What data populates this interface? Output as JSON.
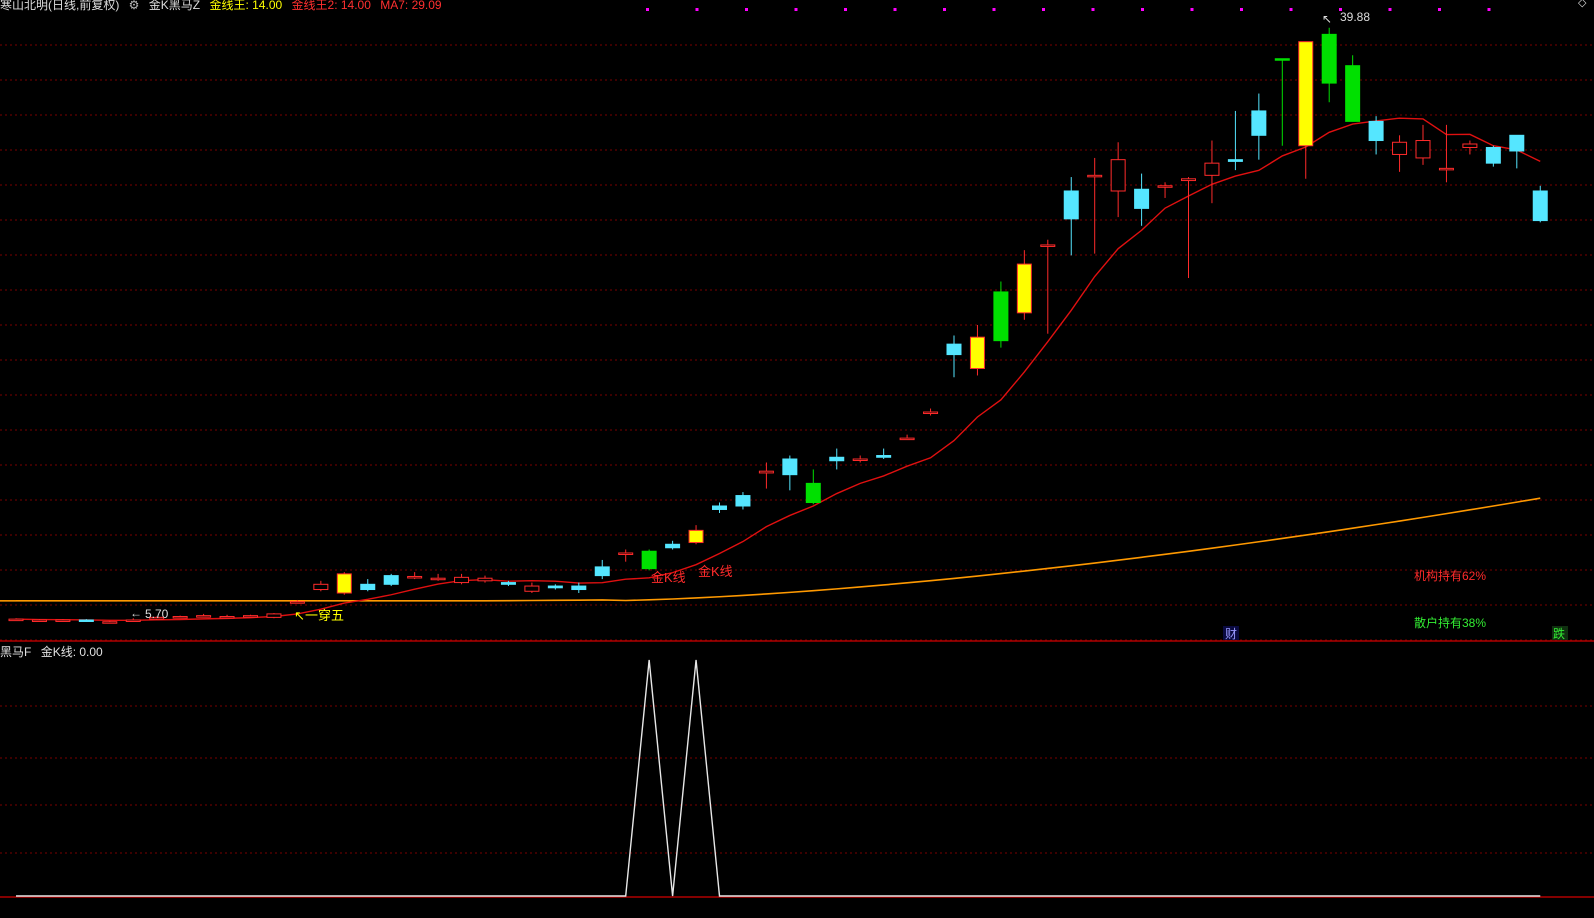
{
  "header": {
    "title": "寒山北明(日线,前复权)",
    "indicator": "金K黑马Z",
    "jxz": "金线王: 14.00",
    "jxz2": "金线王2: 14.00",
    "ma": "MA7: 29.09"
  },
  "subheader": {
    "name": "黑马F",
    "value": "金K线: 0.00"
  },
  "colors": {
    "background": "#000000",
    "grid": "#7a0000",
    "divider": "#b00000",
    "up_candle": "#ff2b2b",
    "yellow_candle": "#ffff00",
    "green_candle": "#00e000",
    "cyan_candle": "#55e6ff",
    "ma_line": "#e01010",
    "long_ma": "#ff9900",
    "signal_line": "#e8e8e8",
    "magenta_dots": "#ff00ff"
  },
  "chart_data": [
    {
      "type": "candlestick",
      "title": "",
      "series": [
        {
          "name": "K线",
          "candles": [
            [
              5.9,
              5.9,
              5.95,
              5.85
            ],
            [
              5.85,
              5.85,
              5.9,
              5.8
            ],
            [
              5.8,
              5.85,
              5.9,
              5.75
            ],
            [
              5.85,
              5.8,
              5.9,
              5.75
            ],
            [
              5.7,
              5.75,
              5.8,
              5.7
            ],
            [
              5.8,
              5.85,
              5.95,
              5.75
            ],
            [
              5.9,
              6.0,
              6.05,
              5.85
            ],
            [
              6.0,
              6.05,
              6.1,
              5.95
            ],
            [
              6.05,
              6.1,
              6.2,
              6.0
            ],
            [
              6.05,
              6.05,
              6.15,
              6.0
            ],
            [
              6.05,
              6.1,
              6.15,
              6.0
            ],
            [
              6.0,
              6.2,
              6.25,
              5.95
            ],
            [
              6.9,
              6.9,
              7.0,
              6.85
            ],
            [
              7.6,
              7.9,
              8.1,
              7.5
            ],
            [
              7.4,
              8.5,
              8.6,
              7.3
            ],
            [
              7.9,
              7.6,
              8.2,
              7.5
            ],
            [
              8.4,
              7.9,
              8.5,
              7.8
            ],
            [
              8.3,
              8.35,
              8.6,
              8.2
            ],
            [
              8.2,
              8.25,
              8.5,
              8.1
            ],
            [
              8.0,
              8.3,
              8.5,
              7.9
            ],
            [
              8.1,
              8.25,
              8.4,
              8.0
            ],
            [
              8.0,
              7.9,
              8.1,
              7.8
            ],
            [
              7.5,
              7.8,
              8.0,
              7.4
            ],
            [
              7.8,
              7.7,
              7.9,
              7.6
            ],
            [
              7.8,
              7.6,
              8.0,
              7.4
            ],
            [
              8.9,
              8.4,
              9.3,
              8.2
            ],
            [
              9.7,
              9.7,
              9.9,
              9.2
            ],
            [
              9.8,
              8.8,
              9.9,
              8.7
            ],
            [
              10.2,
              10.0,
              10.4,
              9.9
            ],
            [
              10.3,
              11.0,
              11.3,
              10.2
            ],
            [
              12.4,
              12.2,
              12.6,
              12.0
            ],
            [
              13.0,
              12.4,
              13.2,
              12.2
            ],
            [
              14.3,
              14.4,
              14.9,
              13.4
            ],
            [
              15.1,
              14.2,
              15.3,
              13.3
            ],
            [
              13.7,
              12.6,
              14.5,
              12.5
            ],
            [
              15.2,
              15.0,
              15.7,
              14.5
            ],
            [
              15.1,
              15.1,
              15.3,
              14.9
            ],
            [
              15.3,
              15.2,
              15.7,
              15.1
            ],
            [
              16.3,
              16.3,
              16.5,
              16.2
            ],
            [
              17.8,
              17.8,
              18.0,
              17.6
            ],
            [
              21.7,
              21.1,
              22.2,
              19.8
            ],
            [
              20.3,
              22.1,
              22.8,
              19.9
            ],
            [
              24.7,
              21.9,
              25.3,
              21.5
            ],
            [
              23.5,
              26.3,
              27.1,
              23.1
            ],
            [
              27.4,
              27.4,
              27.7,
              22.3
            ],
            [
              30.5,
              28.9,
              31.3,
              26.8
            ],
            [
              31.4,
              31.4,
              32.4,
              26.9
            ],
            [
              30.5,
              32.3,
              33.3,
              29.0
            ],
            [
              30.6,
              29.5,
              31.5,
              28.5
            ],
            [
              30.8,
              30.8,
              31.0,
              30.1
            ],
            [
              31.1,
              31.2,
              31.3,
              25.5
            ],
            [
              31.4,
              32.1,
              33.4,
              29.8
            ],
            [
              32.3,
              32.2,
              35.1,
              31.7
            ],
            [
              35.1,
              33.7,
              36.1,
              32.3
            ],
            [
              38.1,
              38.1,
              38.1,
              33.1
            ],
            [
              39.08,
              33.1,
              39.08,
              31.2
            ],
            [
              39.5,
              36.7,
              39.88,
              35.6
            ],
            [
              37.7,
              34.5,
              38.3,
              34.6
            ],
            [
              34.5,
              33.4,
              34.8,
              32.6
            ],
            [
              32.6,
              33.3,
              33.7,
              31.6
            ],
            [
              32.4,
              33.4,
              34.3,
              32.0
            ],
            [
              31.8,
              31.8,
              34.3,
              31.0
            ],
            [
              33.0,
              33.2,
              33.4,
              32.6
            ],
            [
              33.0,
              32.1,
              33.1,
              31.9
            ],
            [
              33.7,
              32.8,
              32.9,
              31.8
            ],
            [
              30.5,
              28.8,
              30.8,
              28.7
            ]
          ]
        }
      ],
      "annotations": [
        "39.88",
        "5.70",
        "一穿五",
        "金K线",
        "金K线",
        "机构持有62%",
        "散户持有38%",
        "财",
        "跌"
      ],
      "ylim": [
        4.7,
        40.9
      ],
      "grid": true
    },
    {
      "type": "line",
      "title": "",
      "series": [
        {
          "name": "金K线",
          "values": [
            0,
            0,
            0,
            0,
            0,
            0,
            0,
            0,
            0,
            0,
            0,
            0,
            0,
            0,
            0,
            0,
            0,
            0,
            0,
            0,
            0,
            0,
            0,
            0,
            0,
            0,
            0,
            1,
            0,
            1,
            0,
            0,
            0,
            0,
            0,
            0,
            0,
            0,
            0,
            0,
            0,
            0,
            0,
            0,
            0,
            0,
            0,
            0,
            0,
            0,
            0,
            0,
            0,
            0,
            0,
            0,
            0,
            0,
            0,
            0,
            0,
            0,
            0,
            0,
            0,
            0
          ]
        }
      ],
      "ylim": [
        0,
        1
      ],
      "grid": true
    }
  ]
}
